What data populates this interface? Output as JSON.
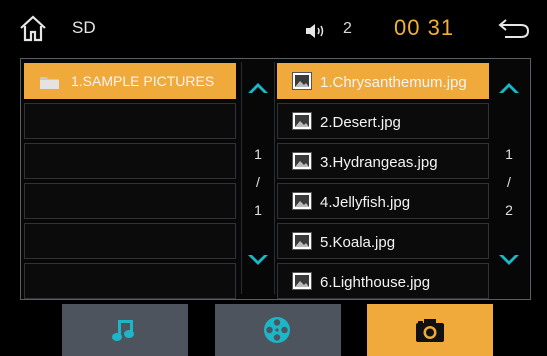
{
  "header": {
    "home_icon": "home-icon",
    "source": "SD",
    "volume_icon": "speaker-icon",
    "volume": "2",
    "time": "00 31",
    "back_icon": "return-arrow-icon",
    "time_color": "#f2b03a"
  },
  "folders": {
    "items": [
      {
        "label": "1.SAMPLE PICTURES",
        "selected": true
      },
      {
        "label": ""
      },
      {
        "label": ""
      },
      {
        "label": ""
      },
      {
        "label": ""
      },
      {
        "label": ""
      }
    ],
    "page_current": "1",
    "page_sep": "/",
    "page_total": "1"
  },
  "files": {
    "items": [
      {
        "label": "1.Chrysanthemum.jpg",
        "selected": true
      },
      {
        "label": "2.Desert.jpg"
      },
      {
        "label": "3.Hydrangeas.jpg"
      },
      {
        "label": "4.Jellyfish.jpg"
      },
      {
        "label": "5.Koala.jpg"
      },
      {
        "label": "6.Lighthouse.jpg"
      }
    ],
    "page_current": "1",
    "page_sep": "/",
    "page_total": "2"
  },
  "tabs": [
    {
      "icon": "music-note-icon",
      "active": false
    },
    {
      "icon": "video-reel-icon",
      "active": false
    },
    {
      "icon": "camera-icon",
      "active": true
    }
  ],
  "colors": {
    "accent": "#f0a93b",
    "arrow": "#1bb7c9",
    "tab_bg": "#4d545e"
  }
}
